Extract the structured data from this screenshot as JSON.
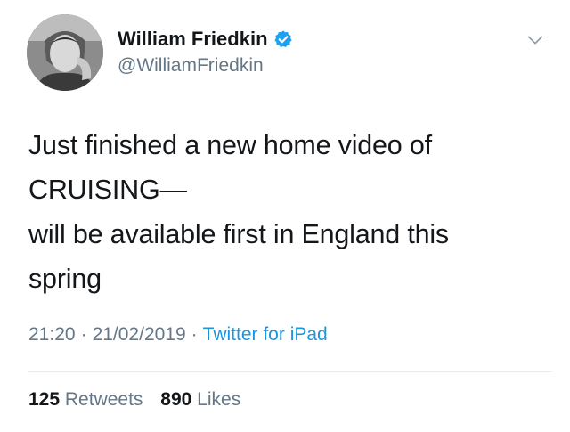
{
  "author": {
    "display_name": "William Friedkin",
    "handle": "@WilliamFriedkin",
    "verified": true,
    "avatar_icon": "profile-photo"
  },
  "tweet": {
    "text_lines": [
      "Just finished a new home video of",
      "CRUISING—",
      "will be available first in England this",
      "spring"
    ],
    "time": "21:20",
    "date": "21/02/2019",
    "source": "Twitter for iPad",
    "separator": "·"
  },
  "stats": {
    "retweets_count": "125",
    "retweets_label": "Retweets",
    "likes_count": "890",
    "likes_label": "Likes"
  },
  "icons": {
    "verified": "verified-badge-icon",
    "menu": "chevron-down-icon"
  },
  "colors": {
    "text_primary": "#14171a",
    "text_secondary": "#657786",
    "link": "#1b95e0",
    "verified_badge": "#1da1f2",
    "divider": "#e6ecf0"
  }
}
